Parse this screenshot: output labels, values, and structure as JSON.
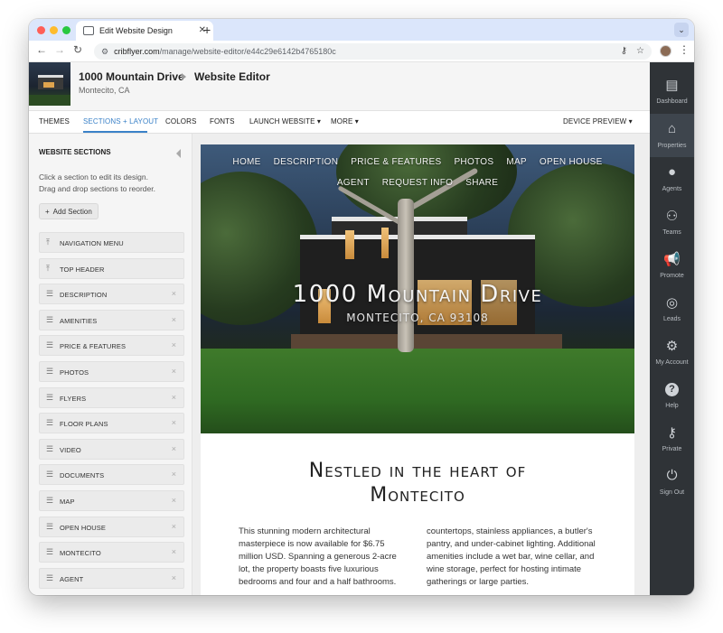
{
  "browser": {
    "tab_title": "Edit Website Design",
    "url_host": "cribflyer.com",
    "url_path": "/manage/website-editor/e44c29e6142b4765180c"
  },
  "header": {
    "property_name": "1000 Mountain Drive",
    "page_title": "Website Editor",
    "location": "Montecito, CA"
  },
  "editor_tabs": [
    {
      "label": "THEMES"
    },
    {
      "label": "SECTIONS + LAYOUT"
    },
    {
      "label": "COLORS"
    },
    {
      "label": "FONTS"
    },
    {
      "label": "LAUNCH WEBSITE"
    },
    {
      "label": "MORE"
    },
    {
      "label": "DEVICE PREVIEW"
    }
  ],
  "sidebar": {
    "title": "WEBSITE SECTIONS",
    "help_line1": "Click a section to edit its design.",
    "help_line2": "Drag and drop sections to reorder.",
    "add_label": "Add Section",
    "sections": [
      {
        "label": "NAVIGATION MENU",
        "fixed": true
      },
      {
        "label": "TOP HEADER",
        "fixed": true
      },
      {
        "label": "DESCRIPTION",
        "fixed": false
      },
      {
        "label": "AMENITIES",
        "fixed": false
      },
      {
        "label": "PRICE & FEATURES",
        "fixed": false
      },
      {
        "label": "PHOTOS",
        "fixed": false
      },
      {
        "label": "FLYERS",
        "fixed": false
      },
      {
        "label": "FLOOR PLANS",
        "fixed": false
      },
      {
        "label": "VIDEO",
        "fixed": false
      },
      {
        "label": "DOCUMENTS",
        "fixed": false
      },
      {
        "label": "MAP",
        "fixed": false
      },
      {
        "label": "OPEN HOUSE",
        "fixed": false
      },
      {
        "label": "MONTECITO",
        "fixed": false
      },
      {
        "label": "AGENT",
        "fixed": false
      }
    ]
  },
  "preview": {
    "nav_row1": [
      "HOME",
      "DESCRIPTION",
      "PRICE & FEATURES",
      "PHOTOS",
      "MAP",
      "OPEN HOUSE"
    ],
    "nav_row2": [
      "AGENT",
      "REQUEST INFO",
      "SHARE"
    ],
    "hero_title": "1000 Mountain Drive",
    "hero_subtitle": "MONTECITO, CA 93108",
    "heading_line1": "Nestled in the heart of",
    "heading_line2": "Montecito",
    "col1": "This stunning modern architectural masterpiece is now available for $6.75 million USD. Spanning a generous 2-acre lot, the property boasts five luxurious bedrooms and four and a half bathrooms.",
    "col2": "countertops, stainless appliances, a butler's pantry, and under-cabinet lighting. Additional amenities include a wet bar, wine cellar, and wine storage, perfect for hosting intimate gatherings or large parties."
  },
  "right_nav": [
    {
      "label": "Dashboard",
      "icon": "dashboard-icon"
    },
    {
      "label": "Properties",
      "icon": "properties-icon"
    },
    {
      "label": "Agents",
      "icon": "agent-icon"
    },
    {
      "label": "Teams",
      "icon": "teams-icon"
    },
    {
      "label": "Promote",
      "icon": "megaphone-icon"
    },
    {
      "label": "Leads",
      "icon": "target-icon"
    },
    {
      "label": "My Account",
      "icon": "gear-icon"
    },
    {
      "label": "Help",
      "icon": "help-icon"
    },
    {
      "label": "Private",
      "icon": "key-icon"
    },
    {
      "label": "Sign Out",
      "icon": "power-icon"
    }
  ],
  "colors": {
    "accent": "#3b82c8",
    "nav_dark": "#2f3337",
    "nav_active": "#3e454d"
  }
}
